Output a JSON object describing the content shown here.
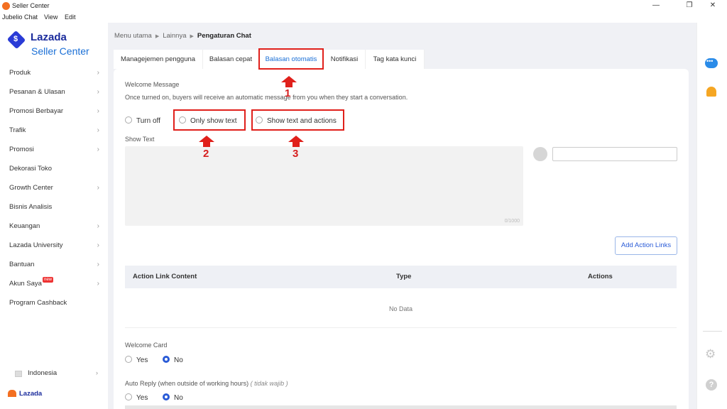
{
  "window": {
    "title": "Seller Center",
    "menu": [
      "Jubelio Chat",
      "View",
      "Edit"
    ],
    "controls": {
      "minimize": "—",
      "restore": "❐",
      "close": "✕"
    }
  },
  "brand": {
    "name": "Lazada",
    "sub": "Seller Center",
    "logo_letter": "$"
  },
  "sidebar": {
    "items": [
      {
        "label": "Produk",
        "chevron": true
      },
      {
        "label": "Pesanan & Ulasan",
        "chevron": true
      },
      {
        "label": "Promosi Berbayar",
        "chevron": true
      },
      {
        "label": "Trafik",
        "chevron": true
      },
      {
        "label": "Promosi",
        "chevron": true
      },
      {
        "label": "Dekorasi Toko",
        "chevron": false
      },
      {
        "label": "Growth Center",
        "chevron": true
      },
      {
        "label": "Bisnis Analisis",
        "chevron": false
      },
      {
        "label": "Keuangan",
        "chevron": true
      },
      {
        "label": "Lazada University",
        "chevron": true
      },
      {
        "label": "Bantuan",
        "chevron": true
      },
      {
        "label": "Akun Saya",
        "chevron": true,
        "badge": "new"
      },
      {
        "label": "Program Cashback",
        "chevron": false
      }
    ],
    "language": "Indonesia",
    "footer_brand": "Lazada"
  },
  "breadcrumb": {
    "items": [
      "Menu utama",
      "Lainnya"
    ],
    "current": "Pengaturan Chat"
  },
  "tabs": [
    {
      "label": "Managejemen pengguna"
    },
    {
      "label": "Balasan cepat"
    },
    {
      "label": "Balasan otomatis",
      "active": true
    },
    {
      "label": "Notifikasi"
    },
    {
      "label": "Tag kata kunci"
    }
  ],
  "welcome": {
    "title": "Welcome Message",
    "description": "Once turned on, buyers will receive an automatic message from you when they start a conversation.",
    "options": [
      "Turn off",
      "Only show text",
      "Show text and actions"
    ],
    "show_text_label": "Show Text",
    "char_count": "0/1000"
  },
  "actions": {
    "add_button": "Add Action Links",
    "columns": [
      "Action Link Content",
      "Type",
      "Actions"
    ],
    "empty": "No Data"
  },
  "welcome_card": {
    "title": "Welcome Card",
    "options": [
      "Yes",
      "No"
    ],
    "selected": "No"
  },
  "auto_reply": {
    "title": "Auto Reply (when outside of working hours)",
    "note": "( tidak wajib )",
    "options": [
      "Yes",
      "No"
    ],
    "selected": "No"
  },
  "annotations": [
    "1",
    "2",
    "3"
  ],
  "colors": {
    "annotation": "#e0201b",
    "accent": "#2a5bd7",
    "brand": "#1a2b9c"
  }
}
